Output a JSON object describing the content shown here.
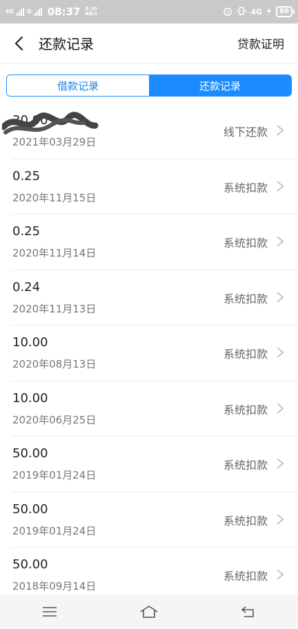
{
  "status_bar": {
    "network_left": "4G",
    "network_right": "G",
    "time": "08:37",
    "speed_value": "5.30",
    "speed_unit": "KB/s",
    "network_4g_right": "4G",
    "battery": "80"
  },
  "header": {
    "title": "还款记录",
    "right_link": "贷款证明"
  },
  "tabs": [
    {
      "label": "借款记录",
      "active": false
    },
    {
      "label": "还款记录",
      "active": true
    }
  ],
  "records": [
    {
      "amount": "30.00",
      "date": "2021年03月29日",
      "type": "线下还款",
      "redacted": true
    },
    {
      "amount": "0.25",
      "date": "2020年11月15日",
      "type": "系统扣款"
    },
    {
      "amount": "0.25",
      "date": "2020年11月14日",
      "type": "系统扣款"
    },
    {
      "amount": "0.24",
      "date": "2020年11月13日",
      "type": "系统扣款"
    },
    {
      "amount": "10.00",
      "date": "2020年08月13日",
      "type": "系统扣款"
    },
    {
      "amount": "10.00",
      "date": "2020年06月25日",
      "type": "系统扣款"
    },
    {
      "amount": "50.00",
      "date": "2019年01月24日",
      "type": "系统扣款"
    },
    {
      "amount": "50.00",
      "date": "2019年01月24日",
      "type": "系统扣款"
    },
    {
      "amount": "50.00",
      "date": "2018年09月14日",
      "type": "系统扣款"
    }
  ],
  "colors": {
    "accent": "#1a8cff",
    "status_bar": "#c9c9c9"
  }
}
